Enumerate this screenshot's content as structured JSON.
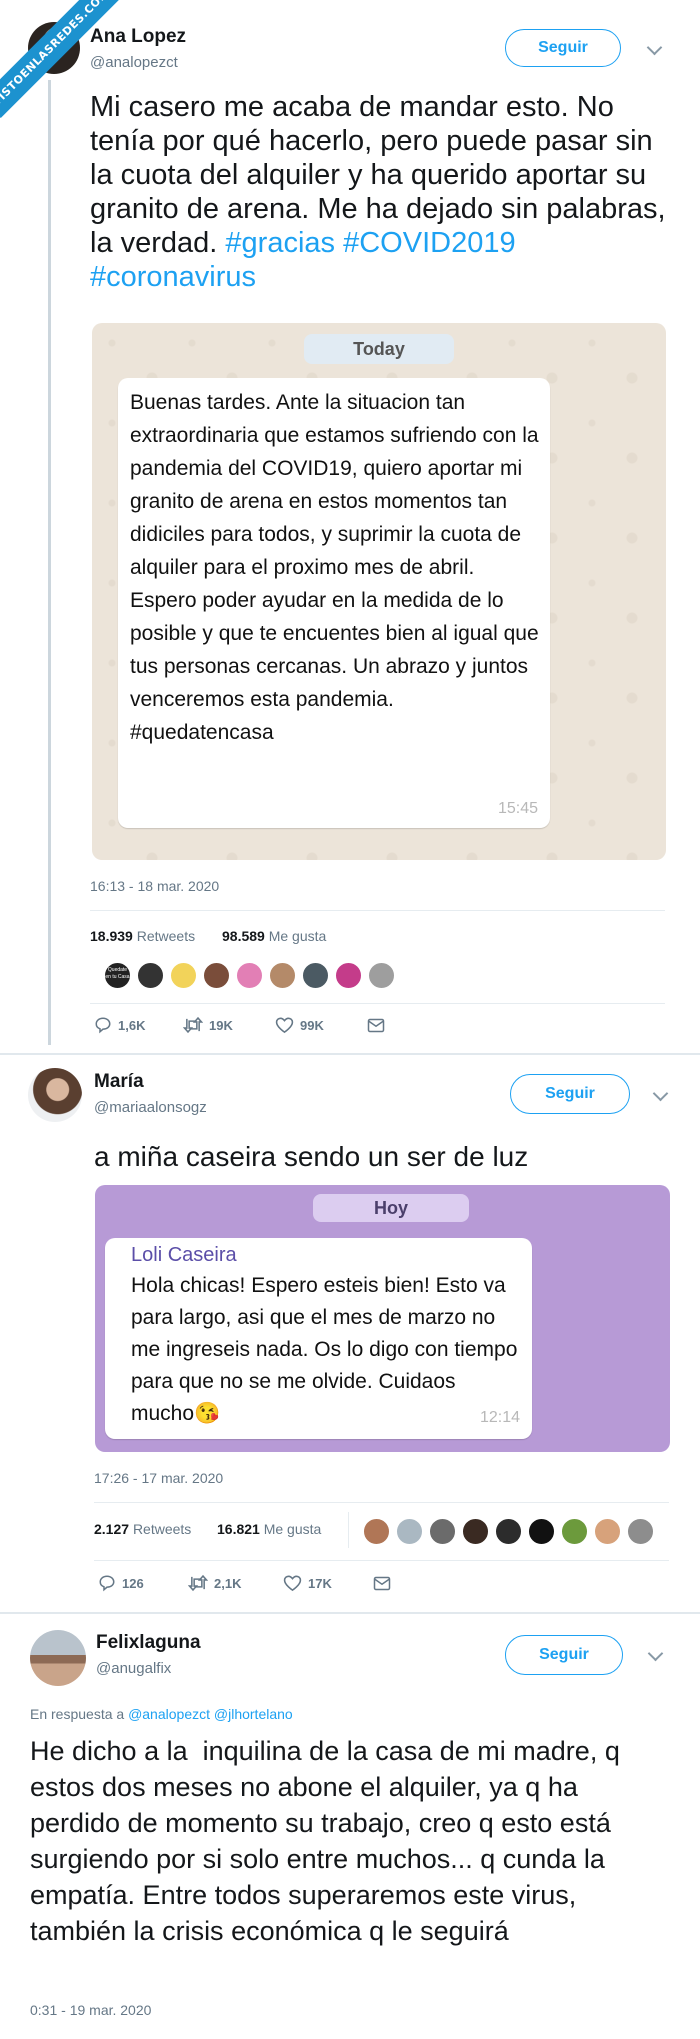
{
  "watermark": "VISTOENLASREDES.COM",
  "tweet1": {
    "name": "Ana Lopez",
    "handle": "@analopezct",
    "follow": "Seguir",
    "text_plain": "Mi casero me acaba de mandar esto. No tenía por qué hacerlo, pero puede pasar sin la cuota del alquiler y ha querido aportar su granito de arena. Me ha dejado sin palabras, la verdad.",
    "hashtags": [
      "#gracias",
      "#COVID2019",
      "#coronavirus"
    ],
    "chat": {
      "day": "Today",
      "message": "Buenas tardes. Ante la situacion tan extraordinaria que estamos sufriendo con la pandemia del COVID19, quiero aportar mi granito de arena en estos momentos tan didiciles para todos, y suprimir la cuota de alquiler para el proximo mes de abril. Espero poder ayudar en la medida de lo posible y que te encuentes bien al igual que tus personas cercanas. Un abrazo y juntos venceremos esta pandemia. #quedatencasa",
      "time": "15:45"
    },
    "timestamp": "16:13 - 18 mar. 2020",
    "retweets": "18.939",
    "retweets_label": "Retweets",
    "likes": "98.589",
    "likes_label": "Me gusta",
    "liker_label": "Quedate en tu Casa",
    "replies_count": "1,6K",
    "rt_count": "19K",
    "like_count": "99K"
  },
  "tweet2": {
    "name": "María",
    "handle": "@mariaalonsogz",
    "follow": "Seguir",
    "text": "a miña caseira sendo un ser de luz",
    "chat": {
      "day": "Hoy",
      "sender": "Loli Caseira",
      "message": "Hola chicas! Espero esteis bien! Esto va para largo, asi que el mes de marzo no me ingreseis nada. Os lo digo con tiempo para que no se me olvide. Cuidaos mucho😘",
      "time": "12:14"
    },
    "timestamp": "17:26 - 17 mar. 2020",
    "retweets": "2.127",
    "retweets_label": "Retweets",
    "likes": "16.821",
    "likes_label": "Me gusta",
    "replies_count": "126",
    "rt_count": "2,1K",
    "like_count": "17K"
  },
  "tweet3": {
    "name": "Felixlaguna",
    "handle": "@anugalfix",
    "follow": "Seguir",
    "reply_prefix": "En respuesta a",
    "reply_mentions": [
      "@analopezct",
      "@jlhortelano"
    ],
    "text": "He dicho a la  inquilina de la casa de mi madre, q estos dos meses no abone el alquiler, ya q ha perdido de momento su trabajo, creo q esto está surgiendo por si solo entre muchos... q cunda la empatía. Entre todos superaremos este virus, también la crisis económica q le seguirá",
    "timestamp": "0:31 - 19 mar. 2020"
  },
  "icons": {
    "reply": "reply-icon",
    "retweet": "retweet-icon",
    "like": "heart-icon",
    "dm": "mail-icon",
    "more": "chevron-down-icon"
  },
  "colors": {
    "link": "#1da1f2",
    "whatsapp_bg": "#ece4d9",
    "telegram_bg": "#b79ad6",
    "telegram_sender": "#5b4ea8",
    "watermark": "#1c92cf"
  }
}
